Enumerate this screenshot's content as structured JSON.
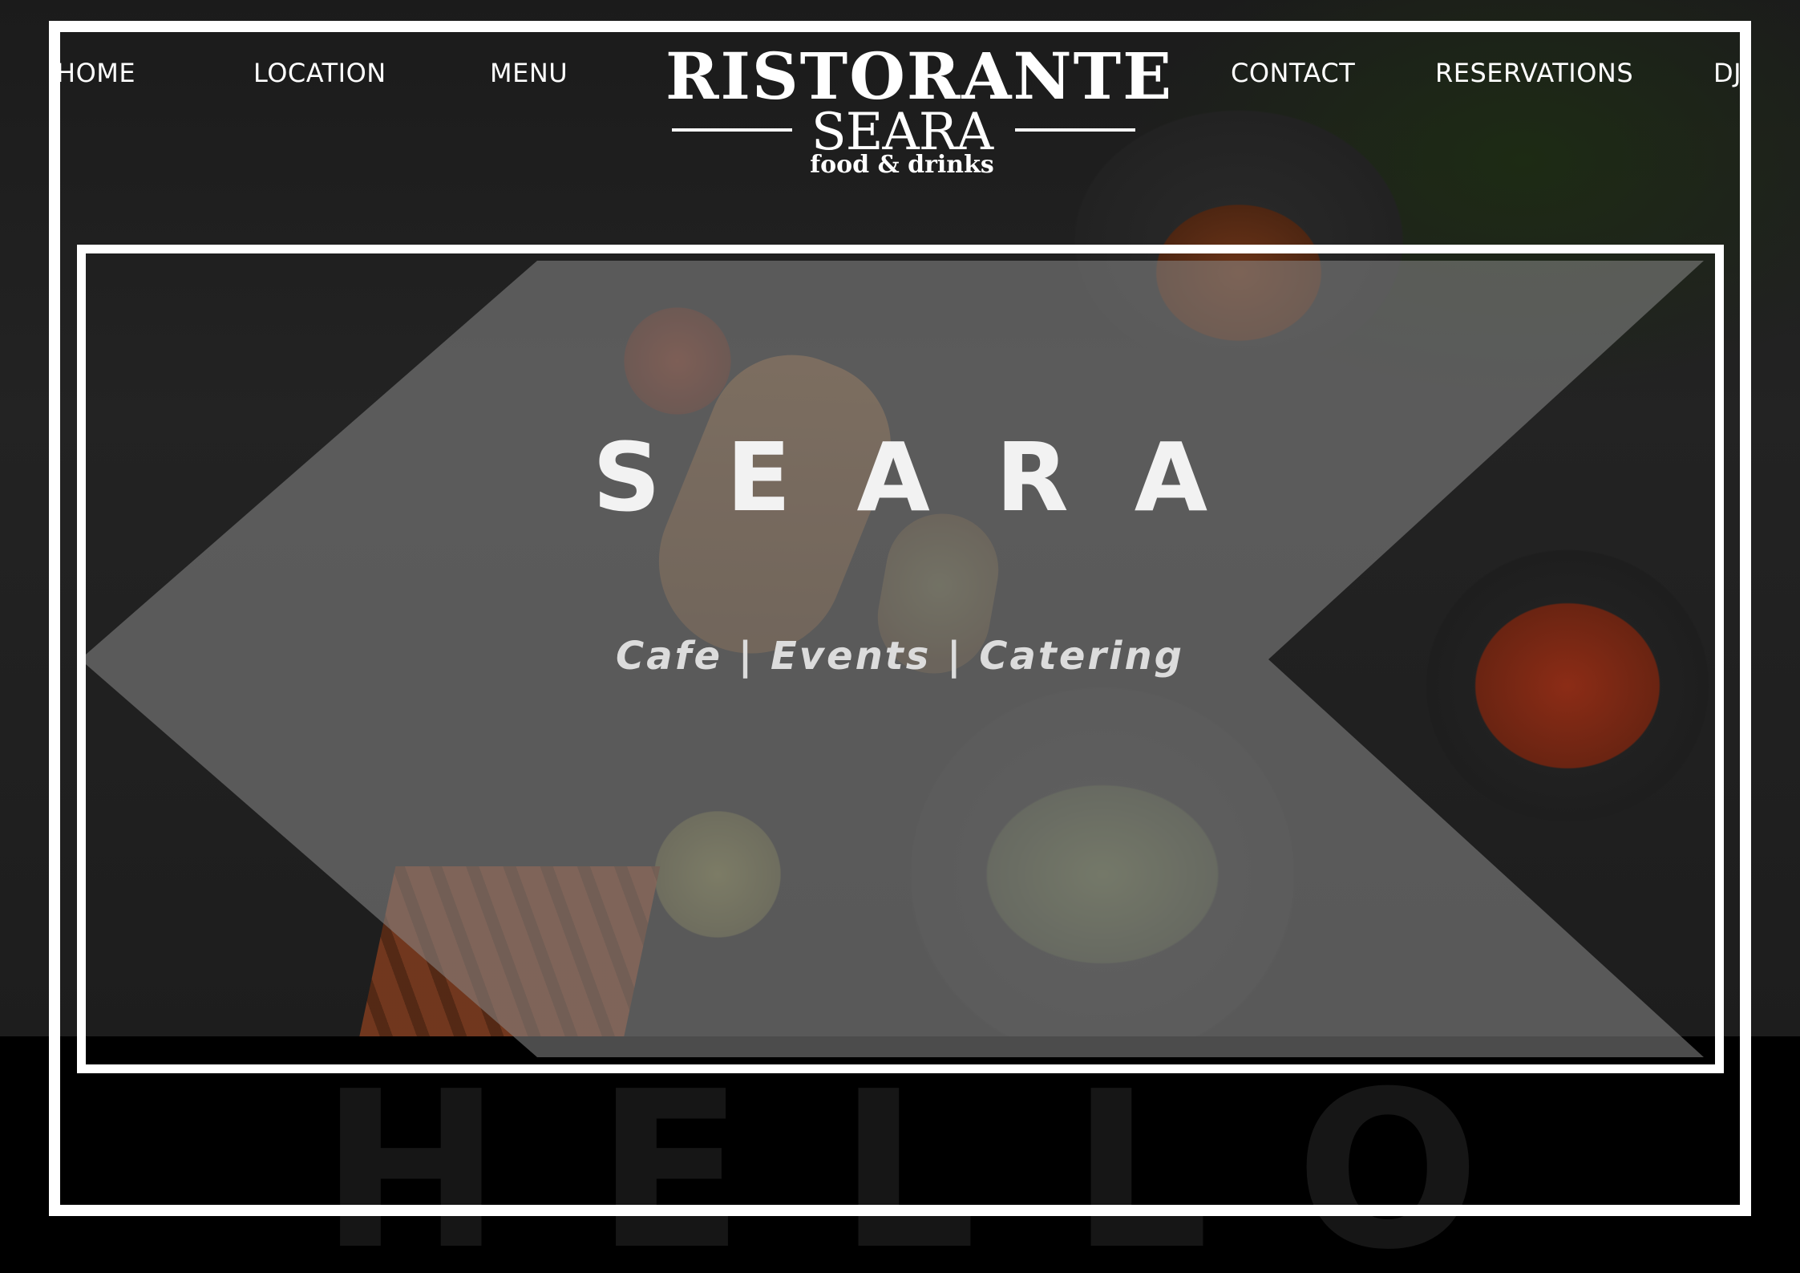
{
  "nav": {
    "left": [
      "HOME",
      "LOCATION",
      "MENU"
    ],
    "right": [
      "CONTACT",
      "RESERVATIONS",
      "DJ"
    ]
  },
  "logo": {
    "line1": "RISTORANTE",
    "line2": "SEARA",
    "line3": "food & drinks"
  },
  "hero": {
    "title": "SEARA",
    "subtitle": "Cafe | Events | Catering"
  },
  "section": {
    "watermark": "HELLO"
  },
  "colors": {
    "background": "#000000",
    "frame": "#ffffff",
    "overlay": "#8a8a8a"
  }
}
